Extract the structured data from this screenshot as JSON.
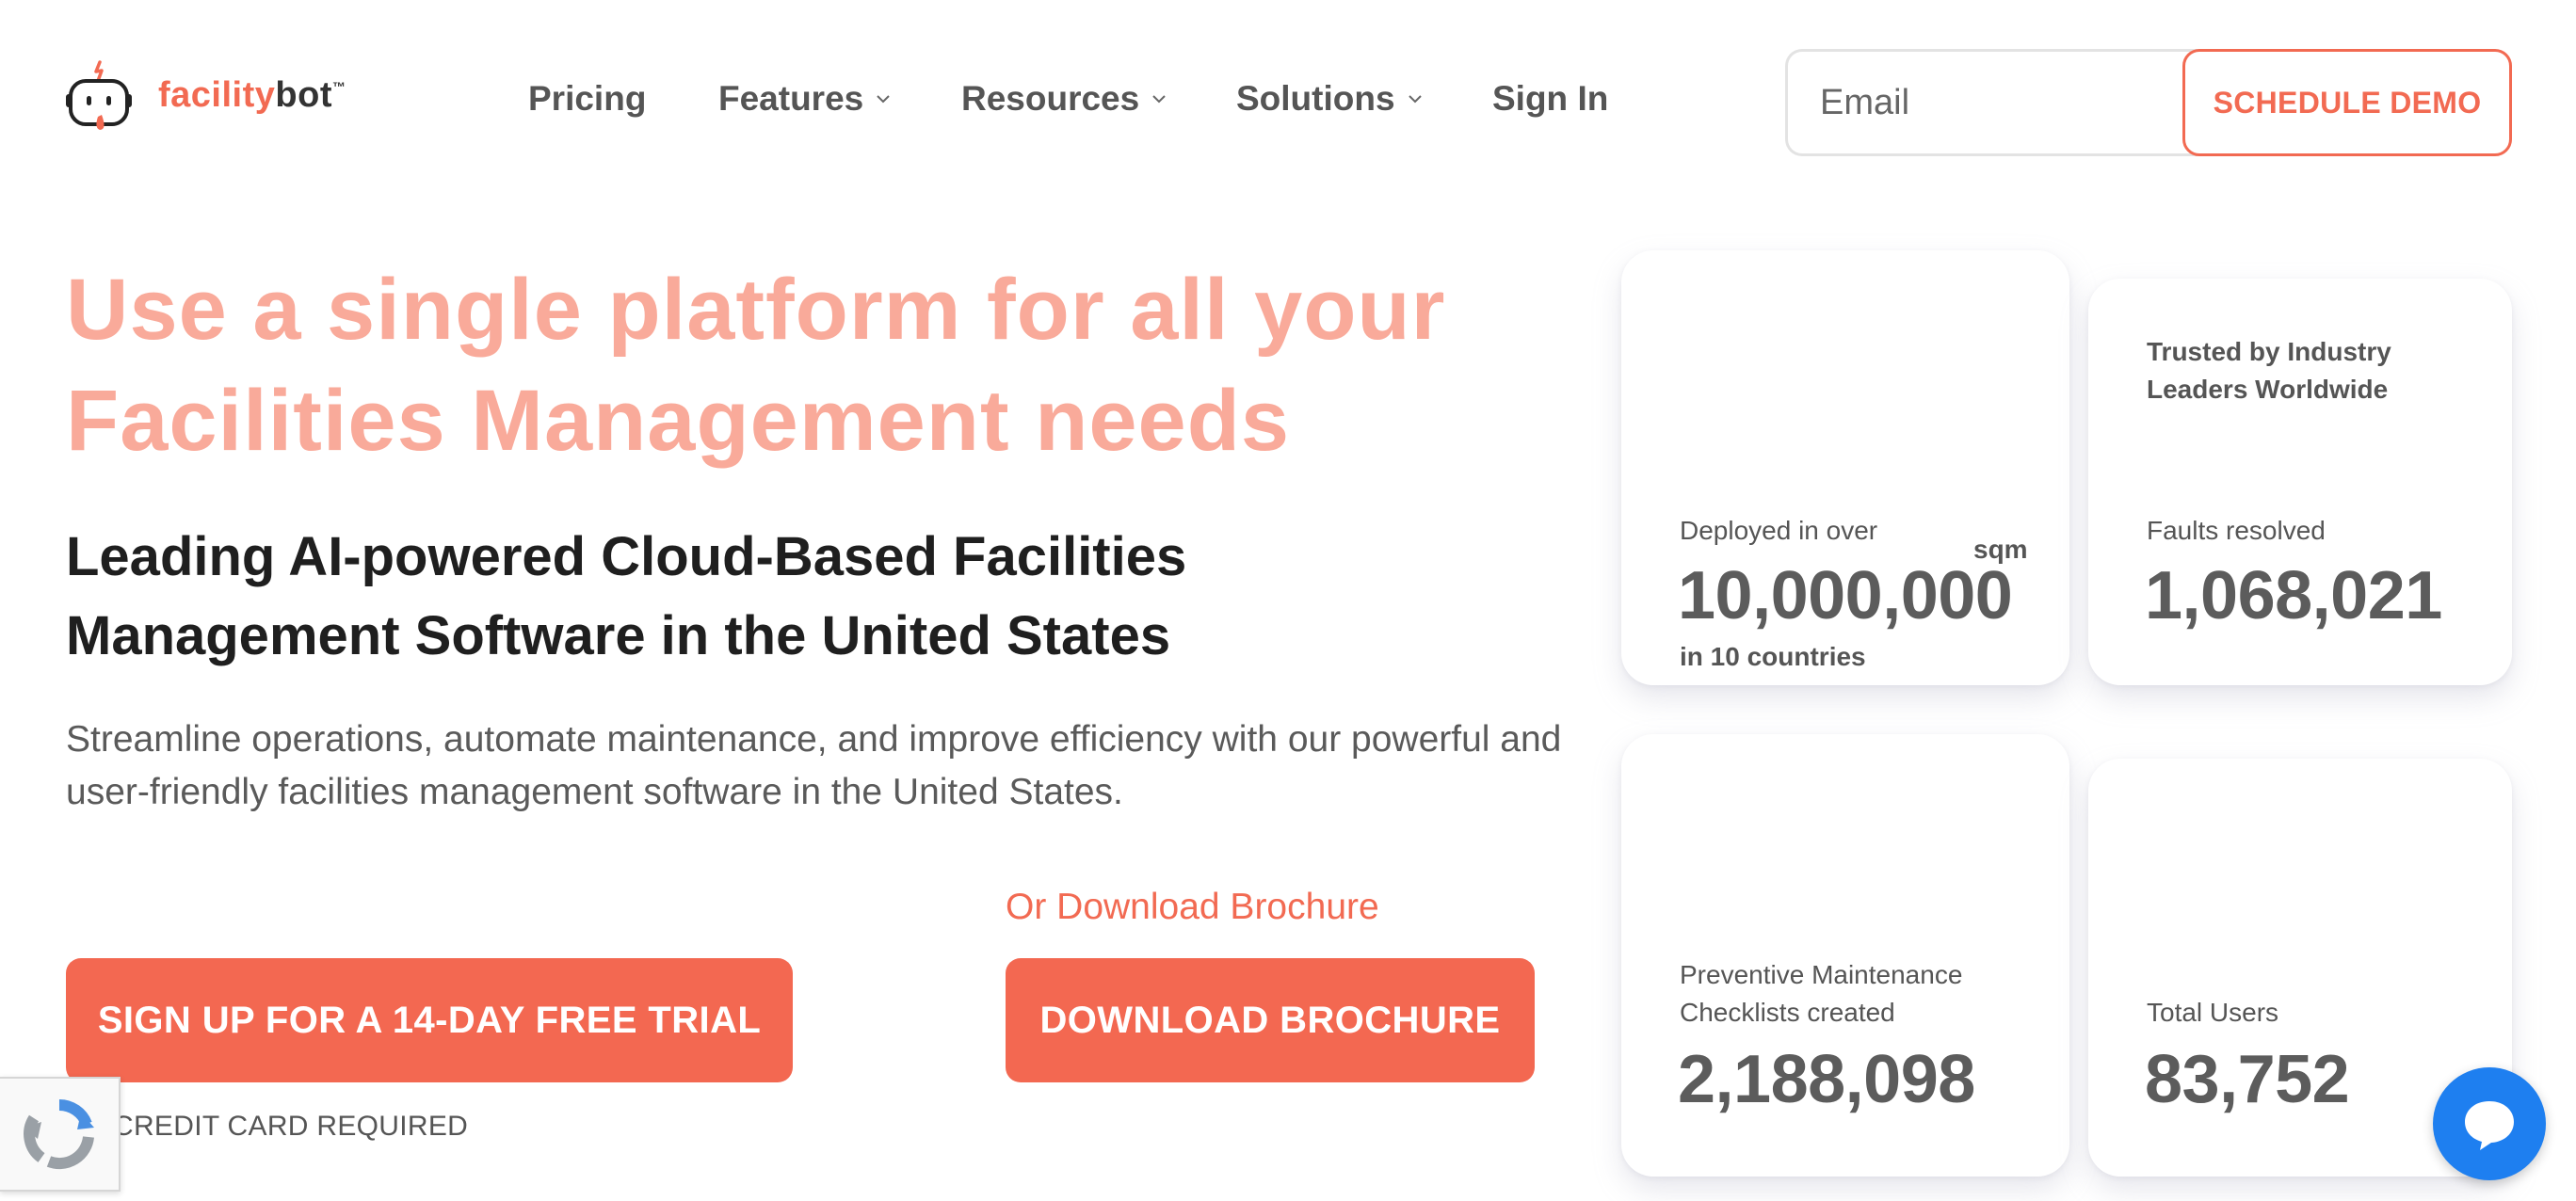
{
  "brand": {
    "name_part1": "facility",
    "name_part2": "bot",
    "trademark": "™",
    "accent_color": "#f26a52",
    "logo_icon": "robot-face-icon"
  },
  "nav": {
    "items": [
      {
        "label": "Pricing",
        "has_dropdown": false
      },
      {
        "label": "Features",
        "has_dropdown": true
      },
      {
        "label": "Resources",
        "has_dropdown": true
      },
      {
        "label": "Solutions",
        "has_dropdown": true
      },
      {
        "label": "Sign In",
        "has_dropdown": false
      }
    ]
  },
  "header": {
    "email_placeholder": "Email",
    "demo_button": "SCHEDULE DEMO"
  },
  "hero": {
    "title": "Use a single platform for all your Facilities Management needs",
    "subtitle": "Leading AI-powered Cloud-Based Facilities Management Software in the United States",
    "description": "Streamline operations, automate maintenance, and improve efficiency with our powerful and user-friendly facilities management software in the United States.",
    "brochure_link": "Or Download Brochure",
    "trial_button": "SIGN UP FOR A 14-DAY FREE TRIAL",
    "brochure_button": "DOWNLOAD BROCHURE",
    "no_credit_card": "CREDIT CARD REQUIRED"
  },
  "stats": {
    "deployed": {
      "label": "Deployed in over",
      "unit": "sqm",
      "value": "10,000,000",
      "footnote": "in 10 countries"
    },
    "faults": {
      "heading": "Trusted by Industry Leaders Worldwide",
      "label": "Faults resolved",
      "value": "1,068,021"
    },
    "checklists": {
      "label": "Preventive Maintenance Checklists created",
      "value": "2,188,098"
    },
    "users": {
      "label": "Total Users",
      "value": "83,752"
    }
  },
  "colors": {
    "title_pink": "#f9aa9a",
    "button_orange": "#f36851",
    "chat_blue": "#1e7ff0"
  }
}
